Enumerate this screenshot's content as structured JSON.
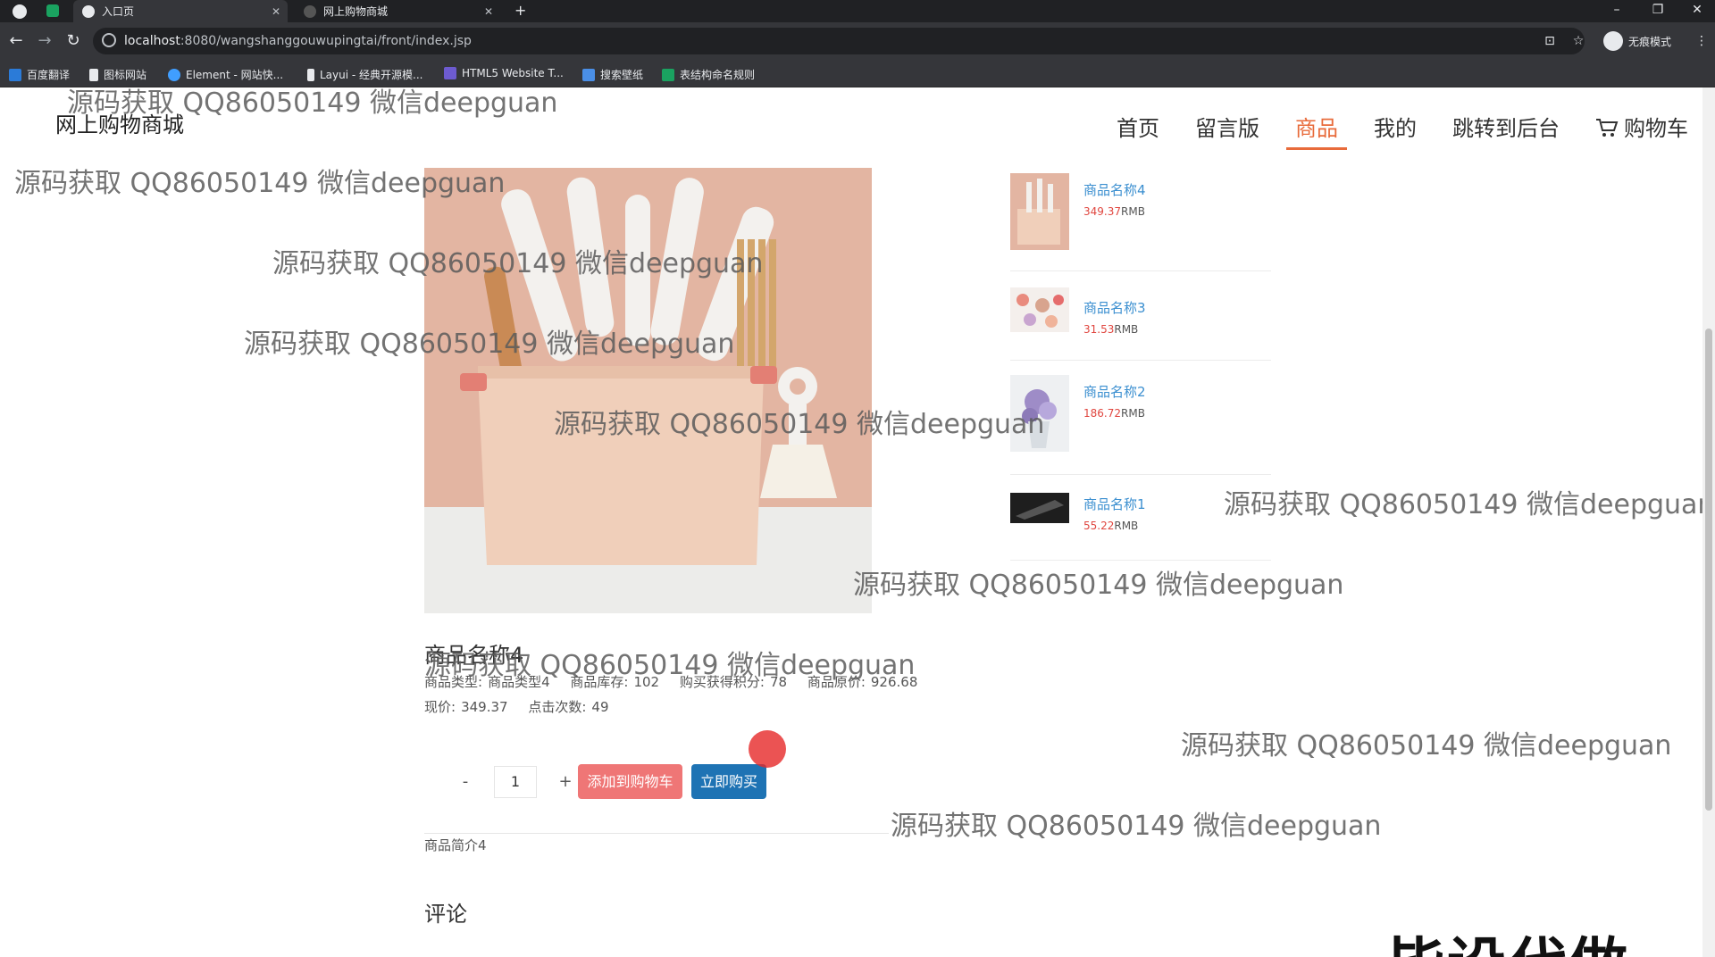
{
  "browser": {
    "tabs": [
      {
        "title": "入口页",
        "active": true
      },
      {
        "title": "网上购物商城",
        "active": false
      }
    ],
    "url_host": "localhost",
    "url_rest": ":8080/wangshanggouwupingtai/front/index.jsp",
    "profile_label": "无痕模式",
    "bookmarks": [
      "百度翻译",
      "图标网站",
      "Element - 网站快...",
      "Layui - 经典开源模...",
      "HTML5 Website T...",
      "搜索壁纸",
      "表结构命名规则"
    ],
    "window_controls": [
      "–",
      "❐",
      "✕"
    ]
  },
  "site": {
    "brand": "网上购物商城",
    "nav": [
      {
        "label": "首页",
        "active": false
      },
      {
        "label": "留言版",
        "active": false
      },
      {
        "label": "商品",
        "active": true
      },
      {
        "label": "我的",
        "active": false
      },
      {
        "label": "跳转到后台",
        "active": false
      },
      {
        "label": "购物车",
        "active": false,
        "icon": "cart-icon"
      }
    ]
  },
  "product": {
    "title": "商品名称4",
    "type_label": "商品类型:",
    "type_value": "商品类型4",
    "stock_label": "商品库存:",
    "stock_value": "102",
    "points_label": "购买获得积分:",
    "points_value": "78",
    "orig_price_label": "商品原价:",
    "orig_price_value": "926.68",
    "price_label": "现价:",
    "price_value": "349.37",
    "clicks_label": "点击次数:",
    "clicks_value": "49",
    "quantity": "1",
    "minus": "-",
    "plus": "+",
    "add_to_cart": "添加到购物车",
    "buy_now": "立即购买",
    "intro": "商品简介4",
    "comments_title": "评论"
  },
  "sidebar": [
    {
      "name": "商品名称4",
      "price": "349.37",
      "unit": "RMB"
    },
    {
      "name": "商品名称3",
      "price": "31.53",
      "unit": "RMB"
    },
    {
      "name": "商品名称2",
      "price": "186.72",
      "unit": "RMB"
    },
    {
      "name": "商品名称1",
      "price": "55.22",
      "unit": "RMB"
    }
  ],
  "watermark": "源码获取 QQ86050149 微信deepguan",
  "overlay_text": "毕设代做",
  "colors": {
    "accent": "#e86b3b",
    "add_btn": "#ef7676",
    "buy_btn": "#1e73b4",
    "link": "#3b8fd0",
    "price": "#e0463f"
  }
}
